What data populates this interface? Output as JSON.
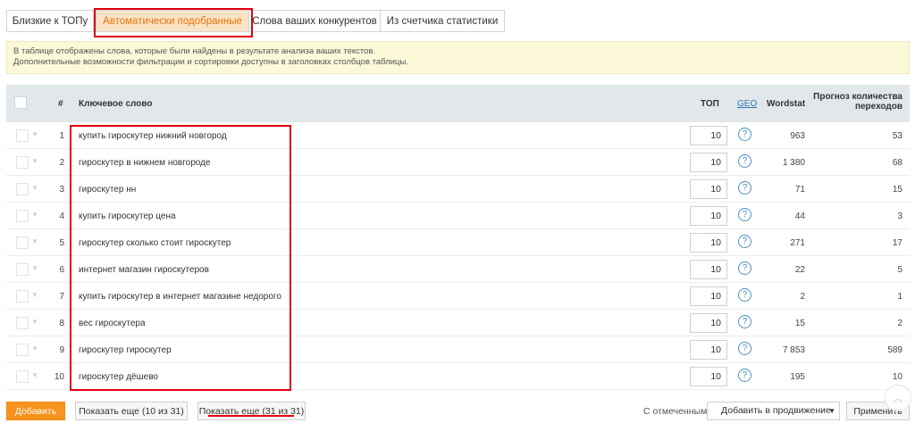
{
  "tabs": [
    {
      "label": "Близкие к ТОПу"
    },
    {
      "label": "Автоматически подобранные"
    },
    {
      "label": "Слова ваших конкурентов"
    },
    {
      "label": "Из счетчика статистики"
    }
  ],
  "info": {
    "line1": "В таблице отображены слова, которые были найдены в результате анализа ваших текстов.",
    "line2": "Дополнительные возможности фильтрации и сортировки доступны в заголовках столбцов таблицы."
  },
  "table": {
    "headers": {
      "num": "#",
      "keyword": "Ключевое слово",
      "top": "ТОП",
      "geo": "GEO",
      "wordstat": "Wordstat",
      "forecast_line1": "Прогноз количества",
      "forecast_line2": "переходов"
    },
    "rows": [
      {
        "num": "1",
        "keyword": "купить гироскутер нижний новгород",
        "top": "10",
        "wordstat": "963",
        "forecast": "53"
      },
      {
        "num": "2",
        "keyword": "гироскутер в нижнем новгороде",
        "top": "10",
        "wordstat": "1 380",
        "forecast": "68"
      },
      {
        "num": "3",
        "keyword": "гироскутер нн",
        "top": "10",
        "wordstat": "71",
        "forecast": "15"
      },
      {
        "num": "4",
        "keyword": "купить гироскутер цена",
        "top": "10",
        "wordstat": "44",
        "forecast": "3"
      },
      {
        "num": "5",
        "keyword": "гироскутер сколько стоит гироскутер",
        "top": "10",
        "wordstat": "271",
        "forecast": "17"
      },
      {
        "num": "6",
        "keyword": "интернет магазин гироскутеров",
        "top": "10",
        "wordstat": "22",
        "forecast": "5"
      },
      {
        "num": "7",
        "keyword": "купить гироскутер в интернет магазине недорого",
        "top": "10",
        "wordstat": "2",
        "forecast": "1"
      },
      {
        "num": "8",
        "keyword": "вес гироскутера",
        "top": "10",
        "wordstat": "15",
        "forecast": "2"
      },
      {
        "num": "9",
        "keyword": "гироскутер гироскутер",
        "top": "10",
        "wordstat": "7 853",
        "forecast": "589"
      },
      {
        "num": "10",
        "keyword": "гироскутер дёшево",
        "top": "10",
        "wordstat": "195",
        "forecast": "10"
      }
    ]
  },
  "footer": {
    "add": "Добавить",
    "more_10": "Показать еще (10 из 31)",
    "more_31": "Показать еще (31 из 31)",
    "with_selected": "С отмеченными:",
    "action_selected": "Добавить в продвижение",
    "apply": "Применить"
  },
  "icons": {
    "question": "?",
    "row_caret": "▼",
    "select_caret": "▼",
    "scroll_top": "︿"
  },
  "colors": {
    "accent_orange": "#f7931e",
    "active_tab_bg": "#fbe3c5",
    "highlight_red": "#e3000f",
    "geo_link": "#2a7ab8"
  }
}
